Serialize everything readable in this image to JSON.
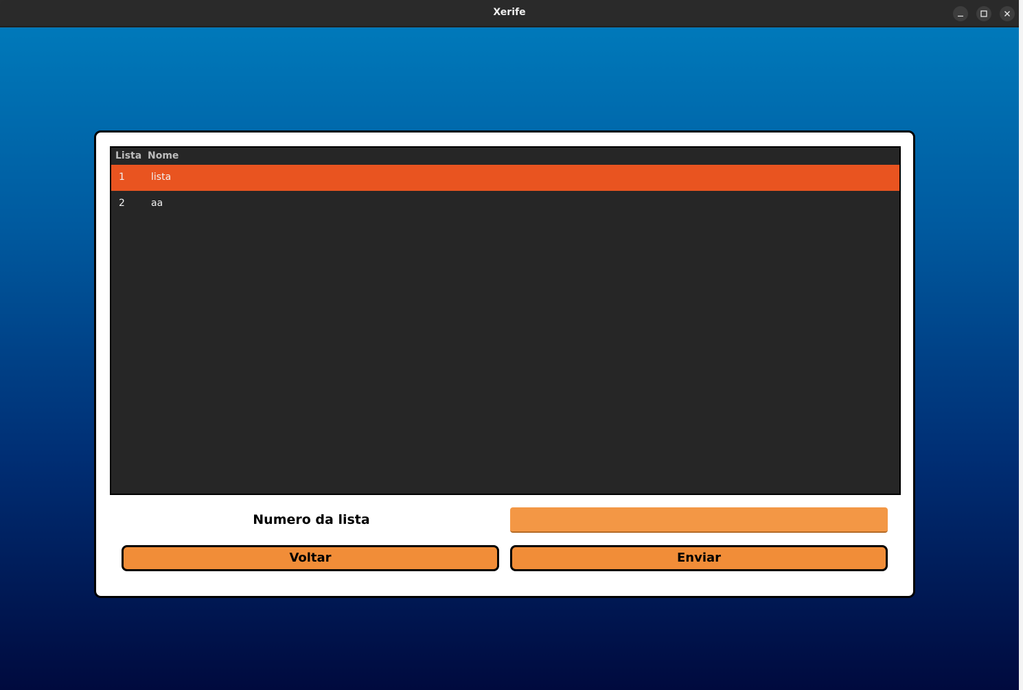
{
  "window": {
    "title": "Xerife",
    "controls": {
      "minimize_icon": "minimize-icon",
      "maximize_icon": "maximize-icon",
      "close_icon": "close-icon"
    }
  },
  "table": {
    "columns": [
      "Lista",
      "Nome"
    ],
    "rows": [
      {
        "lista": "1",
        "nome": "lista",
        "selected": true
      },
      {
        "lista": "2",
        "nome": "aa",
        "selected": false
      }
    ]
  },
  "form": {
    "label": "Numero da lista",
    "input_value": "",
    "back_label": "Voltar",
    "send_label": "Enviar"
  },
  "colors": {
    "selected_row": "#e95420",
    "button": "#f18d38",
    "input": "#f39745",
    "table_bg": "#262626"
  }
}
